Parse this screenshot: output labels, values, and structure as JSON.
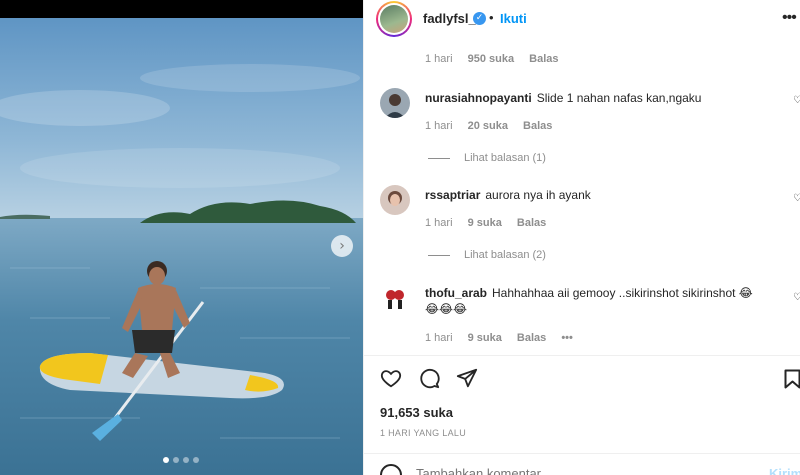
{
  "post": {
    "username": "fadlyfsl_",
    "separator": "•",
    "follow_label": "Ikuti",
    "more_icon": "more-options-icon",
    "verified_icon": "verified-badge-icon",
    "carousel_dots": 4,
    "carousel_active_index": 0
  },
  "top_comment_meta": {
    "time": "1 hari",
    "likes": "950 suka",
    "reply": "Balas"
  },
  "comments": [
    {
      "username": "nurasiahnopayanti",
      "text": "Slide 1 nahan nafas kan,ngaku",
      "time": "1 hari",
      "likes": "20 suka",
      "reply": "Balas",
      "view_replies": "Lihat balasan (1)"
    },
    {
      "username": "rssaptriar",
      "text": "aurora nya ih ayank",
      "time": "1 hari",
      "likes": "9 suka",
      "reply": "Balas",
      "view_replies": "Lihat balasan (2)"
    },
    {
      "username": "thofu_arab",
      "text": "Hahhahhaa aii gemooy ..sikirinshot sikirinshot 😂",
      "text_line2": "😂😂😂",
      "time": "1 hari",
      "likes": "9 suka",
      "reply": "Balas",
      "more": "•••"
    }
  ],
  "footer": {
    "like_count": "91,653 suka",
    "date": "1 HARI YANG LALU",
    "comment_placeholder": "Tambahkan komentar...",
    "post_label": "Kirim"
  },
  "colors": {
    "accent": "#0095f6",
    "verified": "#3897f0",
    "text": "#262626",
    "muted": "#8e8e8e"
  }
}
